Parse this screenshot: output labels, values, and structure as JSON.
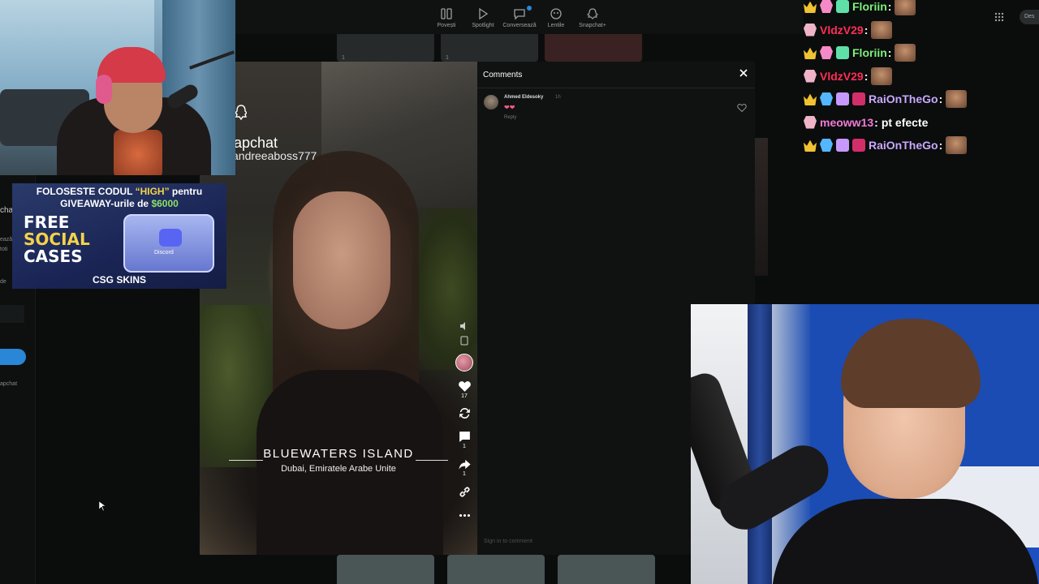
{
  "nav": {
    "items": [
      {
        "label": "Povești",
        "icon": "stories-icon"
      },
      {
        "label": "Spotlight",
        "icon": "play-icon"
      },
      {
        "label": "Conversează",
        "icon": "chat-icon",
        "badge": ""
      },
      {
        "label": "Lentile",
        "icon": "lens-icon"
      },
      {
        "label": "Snapchat+",
        "icon": "ghost-icon"
      }
    ],
    "desk_pill": "Des"
  },
  "thumbs": {
    "labels": [
      "1",
      "1"
    ]
  },
  "sidebar": {
    "text1": "chat",
    "text2": "ează",
    "text3": "toti",
    "text4": "de",
    "text5": "apchat"
  },
  "story": {
    "brand": "apchat",
    "user": "andreeaboss777",
    "location_title": "BLUEWATERS ISLAND",
    "location_subtitle": "Dubai, Emiratele Arabe Unite",
    "likes": "17",
    "comments": "1",
    "shares": "1"
  },
  "comments_panel": {
    "title": "Comments",
    "comment": {
      "author": "Ahmed Eldesoky",
      "time": "1h",
      "text": "❤❤",
      "reply": "Reply"
    },
    "input_placeholder": "Sign in to comment"
  },
  "sponsor": {
    "line1_pre": "FOLOSESTE CODUL ",
    "line1_code": "“HIGH”",
    "line1_post": " pentru",
    "line2_pre": "GIVEAWAY-urile de ",
    "line2_amount": "$6000",
    "free1": "FREE",
    "free2": "SOCIAL",
    "free3": "CASES",
    "case_label": "Discord",
    "brand": "CSG SKINS"
  },
  "chat": [
    {
      "user": "Floriin",
      "color": "#7cf07a",
      "badges": [
        "crown",
        "alien",
        "gift"
      ],
      "message": "",
      "emote": true
    },
    {
      "user": "VldzV29",
      "color": "#ff2e55",
      "badges": [
        "alien-grey"
      ],
      "message": "",
      "emote": true
    },
    {
      "user": "Floriin",
      "color": "#7cf07a",
      "badges": [
        "crown",
        "alien",
        "gift"
      ],
      "message": "",
      "emote": true
    },
    {
      "user": "VldzV29",
      "color": "#ff2e55",
      "badges": [
        "alien-grey"
      ],
      "message": "",
      "emote": true
    },
    {
      "user": "RaiOnTheGo",
      "color": "#c9a8ff",
      "badges": [
        "crown",
        "alien-blue",
        "gift-purple",
        "hype"
      ],
      "message": "",
      "emote": true
    },
    {
      "user": "meoww13",
      "color": "#f27ad8",
      "badges": [
        "alien-grey"
      ],
      "message": "pt efecte",
      "emote": false
    },
    {
      "user": "RaiOnTheGo",
      "color": "#c9a8ff",
      "badges": [
        "crown",
        "alien-blue",
        "gift-purple",
        "hype"
      ],
      "message": "",
      "emote": true
    }
  ]
}
